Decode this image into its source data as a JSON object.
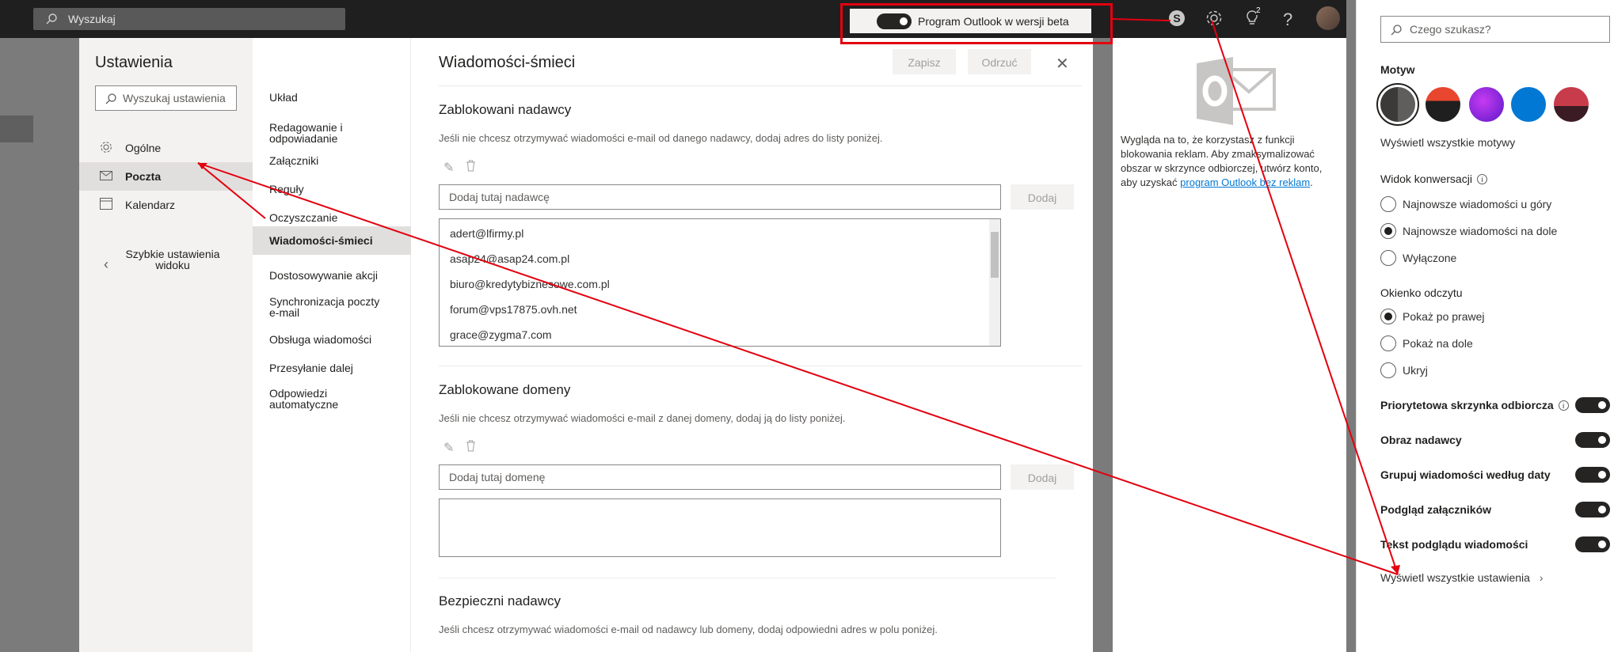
{
  "topbar": {
    "search_placeholder": "Wyszukaj",
    "beta_label": "Program Outlook w wersji beta",
    "notif_count": "2"
  },
  "settings": {
    "title": "Ustawienia",
    "search_placeholder": "Wyszukaj ustawienia",
    "categories": [
      {
        "label": "Ogólne",
        "icon": "gear-icon"
      },
      {
        "label": "Poczta",
        "icon": "mail-icon"
      },
      {
        "label": "Kalendarz",
        "icon": "calendar-icon"
      },
      {
        "label": "Szybkie ustawienia widoku",
        "icon": "chevron-left-icon"
      }
    ],
    "subnav": [
      "Układ",
      "Redagowanie i odpowiadanie",
      "Załączniki",
      "Reguły",
      "Oczyszczanie",
      "Wiadomości-śmieci",
      "Dostosowywanie akcji",
      "Synchronizacja poczty e-mail",
      "Obsługa wiadomości",
      "Przesyłanie dalej",
      "Odpowiedzi automatyczne"
    ]
  },
  "junk": {
    "title": "Wiadomości-śmieci",
    "save": "Zapisz",
    "discard": "Odrzuć",
    "blocked_senders": {
      "title": "Zablokowani nadawcy",
      "desc": "Jeśli nie chcesz otrzymywać wiadomości e-mail od danego nadawcy, dodaj adres do listy poniżej.",
      "placeholder": "Dodaj tutaj nadawcę",
      "add": "Dodaj",
      "items": [
        "adert@lfirmy.pl",
        "asap24@asap24.com.pl",
        "biuro@kredytybiznesowe.com.pl",
        "forum@vps17875.ovh.net",
        "grace@zygma7.com"
      ]
    },
    "blocked_domains": {
      "title": "Zablokowane domeny",
      "desc": "Jeśli nie chcesz otrzymywać wiadomości e-mail z danej domeny, dodaj ją do listy poniżej.",
      "placeholder": "Dodaj tutaj domenę",
      "add": "Dodaj"
    },
    "safe_senders": {
      "title": "Bezpieczni nadawcy",
      "desc": "Jeśli chcesz otrzymywać wiadomości e-mail od nadawcy lub domeny, dodaj odpowiedni adres w polu poniżej."
    }
  },
  "promo": {
    "text_before": "Wygląda na to, że korzystasz z funkcji blokowania reklam. Aby zmaksymalizować obszar w skrzynce odbiorczej, utwórz konto, aby uzyskać ",
    "link": "program Outlook bez reklam",
    "text_after": "."
  },
  "quick_settings": {
    "search_placeholder": "Czego szukasz?",
    "theme_title": "Motyw",
    "view_all_themes": "Wyświetl wszystkie motywy",
    "conversation_title": "Widok konwersacji",
    "conversation_options": [
      "Najnowsze wiadomości u góry",
      "Najnowsze wiadomości na dole",
      "Wyłączone"
    ],
    "conversation_selected": 1,
    "reading_title": "Okienko odczytu",
    "reading_options": [
      "Pokaż po prawej",
      "Pokaż na dole",
      "Ukryj"
    ],
    "reading_selected": 0,
    "toggles": [
      {
        "label": "Priorytetowa skrzynka odbiorcza",
        "on": true
      },
      {
        "label": "Obraz nadawcy",
        "on": true
      },
      {
        "label": "Grupuj wiadomości według daty",
        "on": true
      },
      {
        "label": "Podgląd załączników",
        "on": true
      },
      {
        "label": "Tekst podglądu wiadomości",
        "on": true
      }
    ],
    "view_all_settings": "Wyświetl wszystkie ustawienia",
    "theme_colors": [
      "#3b3a39",
      "#e8462e",
      "#8b2be2",
      "#0078d4",
      "#c73b4b"
    ]
  },
  "colors": {
    "annotation_red": "#e3000f",
    "accent": "#0078d4"
  }
}
